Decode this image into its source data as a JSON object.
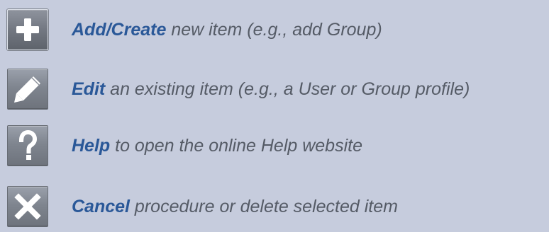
{
  "legend": {
    "items": [
      {
        "icon": "plus-icon",
        "keyword": "Add/Create",
        "description": " new item (e.g., add Group)"
      },
      {
        "icon": "pencil-icon",
        "keyword": "Edit",
        "description": " an existing item (e.g., a User or Group profile)"
      },
      {
        "icon": "question-mark-icon",
        "keyword": "Help",
        "description": " to open the online Help website"
      },
      {
        "icon": "x-icon",
        "keyword": "Cancel",
        "description": " procedure or delete selected item"
      }
    ]
  },
  "colors": {
    "background": "#c6ccdd",
    "keyword": "#2a5898",
    "description": "#555b66",
    "icon_face": "#7f858f",
    "icon_glyph": "#ffffff"
  }
}
